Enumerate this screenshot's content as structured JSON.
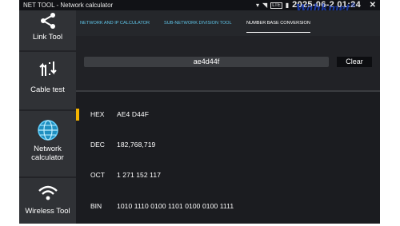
{
  "status_bar": {
    "title": "NET TOOL - Network calculator",
    "date_time": "2025-06-2⁠ 01:24",
    "lte_label": "LTE",
    "watermark": "Wahkmet"
  },
  "sidebar": {
    "items": [
      {
        "label": "Link Tool",
        "icon": "share-icon"
      },
      {
        "label": "Cable test",
        "icon": "cable-test-icon"
      },
      {
        "label": "Network calculator",
        "icon": "globe-icon"
      },
      {
        "label": "Wireless Tool",
        "icon": "wifi-icon"
      }
    ]
  },
  "tabs": [
    {
      "label": "NETWORK AND IP CALCULATOR",
      "active": false
    },
    {
      "label": "SUB-NETWORK DIVISION TOOL",
      "active": false
    },
    {
      "label": "NUMBER BASE CONVERSION",
      "active": true
    }
  ],
  "input": {
    "value": "ae4d44f",
    "clear_label": "Clear"
  },
  "results": [
    {
      "label": "HEX",
      "value": "AE4 D44F"
    },
    {
      "label": "DEC",
      "value": "182,768,719"
    },
    {
      "label": "OCT",
      "value": "1 271 152 117"
    },
    {
      "label": "BIN",
      "value": "1010 1110 0100 1101 0100 0100 1111"
    }
  ],
  "colors": {
    "tab_link": "#5fc3e6",
    "selection_marker": "#f5b400",
    "sidebar_bg": "#303236",
    "content_bg": "#1b1c20"
  }
}
